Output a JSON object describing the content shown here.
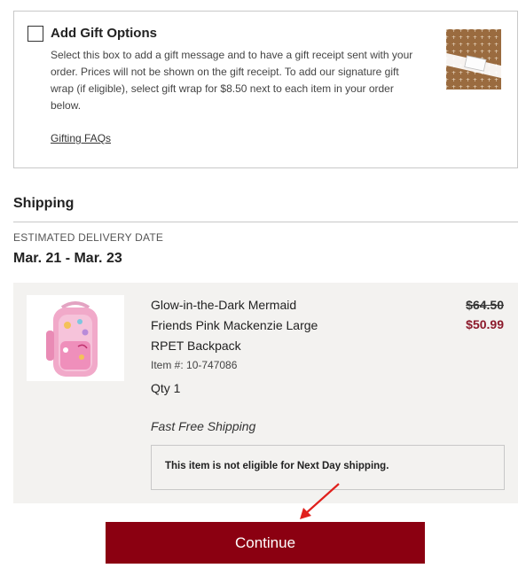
{
  "gift": {
    "title": "Add Gift Options",
    "description": "Select this box to add a gift message and to have a gift receipt sent with your order. Prices will not be shown on the gift receipt. To add our signature gift wrap (if eligible), select gift wrap for $8.50 next to each item in your order below.",
    "faq_link": "Gifting FAQs",
    "checked": false
  },
  "shipping": {
    "heading": "Shipping",
    "delivery_label": "ESTIMATED DELIVERY DATE",
    "delivery_date": "Mar. 21 - Mar. 23"
  },
  "item": {
    "name": "Glow-in-the-Dark Mermaid Friends Pink Mackenzie Large RPET Backpack",
    "sku": "Item #: 10-747086",
    "qty": "Qty 1",
    "price_original": "$64.50",
    "price_sale": "$50.99",
    "shipping_method": "Fast Free Shipping",
    "notice": "This item is not eligible for Next Day shipping."
  },
  "actions": {
    "continue_label": "Continue"
  },
  "colors": {
    "brand": "#8b0011",
    "sale_price": "#8c1a2b",
    "annotation_arrow": "#e0201c"
  }
}
